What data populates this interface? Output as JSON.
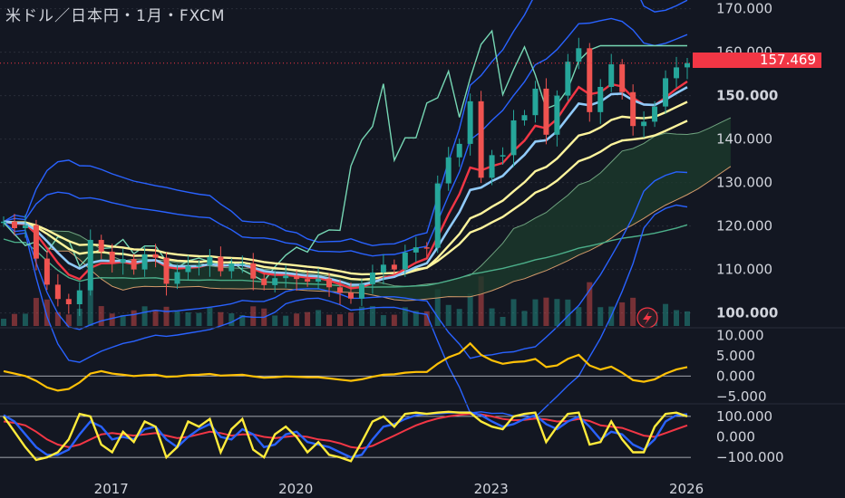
{
  "header": {
    "title": "米ドル／日本円・1月・FXCM"
  },
  "last_price": {
    "label": "157.469",
    "color": "#f23645"
  },
  "colors": {
    "background": "#131722",
    "candle_up": "#26a69a",
    "candle_down": "#ef5350",
    "bollinger": "#2962ff",
    "ema_fast": "#90caf9",
    "ema_red": "#f23645",
    "ema_yellow": "#fff59d",
    "lagging": "#76d7b4",
    "cloud_fill": "#1b3a2c",
    "cloud_edge": "#d39a6a",
    "sma_long": "#4caf8a",
    "macd": "#ffc107",
    "stoch_k": "#ffeb3b",
    "stoch_d": "#2962ff",
    "rsi_slow": "#f23645"
  },
  "chart_data": [
    {
      "type": "candlestick",
      "title": "米ドル／日本円・1月・FXCM",
      "x": [
        "2015-08",
        "2015-10",
        "2015-12",
        "2016-02",
        "2016-04",
        "2016-06",
        "2016-08",
        "2016-10",
        "2016-12",
        "2017-02",
        "2017-04",
        "2017-06",
        "2017-08",
        "2017-10",
        "2017-12",
        "2018-02",
        "2018-04",
        "2018-06",
        "2018-08",
        "2018-10",
        "2018-12",
        "2019-02",
        "2019-04",
        "2019-06",
        "2019-08",
        "2019-10",
        "2019-12",
        "2020-02",
        "2020-04",
        "2020-06",
        "2020-08",
        "2020-10",
        "2020-12",
        "2021-02",
        "2021-04",
        "2021-06",
        "2021-08",
        "2021-10",
        "2021-12",
        "2022-02",
        "2022-04",
        "2022-06",
        "2022-08",
        "2022-10",
        "2022-12",
        "2023-02",
        "2023-04",
        "2023-06",
        "2023-08",
        "2023-10",
        "2023-12",
        "2024-02",
        "2024-04",
        "2024-06",
        "2024-08",
        "2024-10",
        "2024-12",
        "2025-02",
        "2025-04",
        "2025-06",
        "2025-08",
        "2025-10",
        "2025-12",
        "2026-02"
      ],
      "close": [
        121.0,
        119.5,
        120.2,
        112.5,
        106.5,
        103.2,
        102.0,
        105.2,
        116.8,
        114.1,
        111.5,
        112.4,
        110.0,
        113.5,
        112.7,
        106.7,
        109.4,
        110.8,
        111.0,
        112.9,
        109.6,
        111.4,
        111.4,
        107.9,
        106.4,
        108.0,
        108.6,
        107.8,
        107.2,
        107.9,
        105.9,
        104.6,
        103.3,
        106.6,
        109.3,
        111.1,
        110.0,
        113.9,
        115.1,
        115.0,
        129.8,
        135.8,
        138.9,
        148.7,
        131.1,
        136.3,
        136.3,
        144.3,
        145.5,
        151.6,
        141.0,
        150.0,
        157.8,
        160.9,
        146.2,
        152.0,
        157.2,
        150.8,
        143.0,
        144.0,
        147.5,
        154.0,
        156.5,
        157.469
      ],
      "x_axis_ticks": [
        "2017",
        "2020",
        "2023",
        "2026"
      ],
      "y_axis_ticks": [
        "170.000",
        "160.000",
        "150.000",
        "140.000",
        "130.000",
        "120.000",
        "110.000",
        "100.000"
      ],
      "ylim": [
        97,
        172
      ]
    },
    {
      "type": "line",
      "name_hidden": true,
      "y_axis_ticks": [
        "10.000",
        "5.000",
        "0.000",
        "−5.000"
      ],
      "ylim": [
        -5.5,
        10.5
      ],
      "series": [
        {
          "values": [
            1.2,
            0.6,
            0.0,
            -1.2,
            -2.8,
            -3.6,
            -3.2,
            -1.6,
            0.6,
            1.2,
            0.6,
            0.3,
            0.0,
            0.2,
            0.3,
            -0.2,
            -0.1,
            0.2,
            0.3,
            0.5,
            0.1,
            0.2,
            0.3,
            -0.1,
            -0.4,
            -0.3,
            -0.1,
            -0.2,
            -0.3,
            -0.3,
            -0.6,
            -0.9,
            -1.2,
            -0.8,
            -0.2,
            0.3,
            0.4,
            0.8,
            1.0,
            1.0,
            3.0,
            4.6,
            5.6,
            8.0,
            5.2,
            3.8,
            3.0,
            3.4,
            3.6,
            4.2,
            2.2,
            2.6,
            4.2,
            5.2,
            2.6,
            1.6,
            2.3,
            0.8,
            -1.0,
            -1.4,
            -0.8,
            0.6,
            1.6,
            2.2
          ]
        }
      ]
    },
    {
      "type": "line",
      "y_axis_ticks": [
        "100.000",
        "0.000",
        "−100.000"
      ],
      "ylim": [
        -115,
        115
      ],
      "series": [
        {
          "values": [
            80,
            20,
            -40,
            -90,
            -80,
            -60,
            -10,
            90,
            80,
            -30,
            -60,
            20,
            -20,
            60,
            40,
            -80,
            -40,
            60,
            40,
            70,
            -60,
            30,
            70,
            -50,
            -80,
            10,
            40,
            0,
            -60,
            -20,
            -70,
            -80,
            -95,
            -20,
            60,
            80,
            40,
            90,
            95,
            90,
            95,
            98,
            95,
            95,
            60,
            40,
            30,
            80,
            90,
            95,
            -20,
            40,
            90,
            95,
            -30,
            -20,
            60,
            -10,
            -60,
            -60,
            40,
            90,
            95,
            80
          ]
        },
        {
          "values": [
            85,
            60,
            10,
            -40,
            -70,
            -70,
            -50,
            10,
            60,
            40,
            -10,
            0,
            -10,
            30,
            40,
            -10,
            -40,
            0,
            30,
            50,
            0,
            -10,
            30,
            10,
            -40,
            -30,
            10,
            20,
            -20,
            -30,
            -40,
            -60,
            -80,
            -70,
            -10,
            40,
            50,
            70,
            85,
            90,
            92,
            95,
            96,
            96,
            85,
            60,
            40,
            50,
            70,
            85,
            50,
            30,
            60,
            80,
            40,
            -10,
            20,
            10,
            -30,
            -50,
            -10,
            60,
            85,
            88
          ]
        },
        {
          "values": [
            60,
            55,
            45,
            20,
            -10,
            -30,
            -40,
            -30,
            -10,
            10,
            15,
            10,
            5,
            10,
            15,
            5,
            -5,
            0,
            10,
            20,
            15,
            5,
            10,
            10,
            0,
            -5,
            0,
            5,
            0,
            -10,
            -15,
            -25,
            -40,
            -45,
            -35,
            -15,
            5,
            25,
            45,
            60,
            72,
            80,
            86,
            90,
            88,
            80,
            70,
            65,
            66,
            72,
            68,
            60,
            62,
            70,
            62,
            45,
            40,
            35,
            20,
            5,
            0,
            15,
            30,
            45
          ]
        }
      ]
    }
  ]
}
